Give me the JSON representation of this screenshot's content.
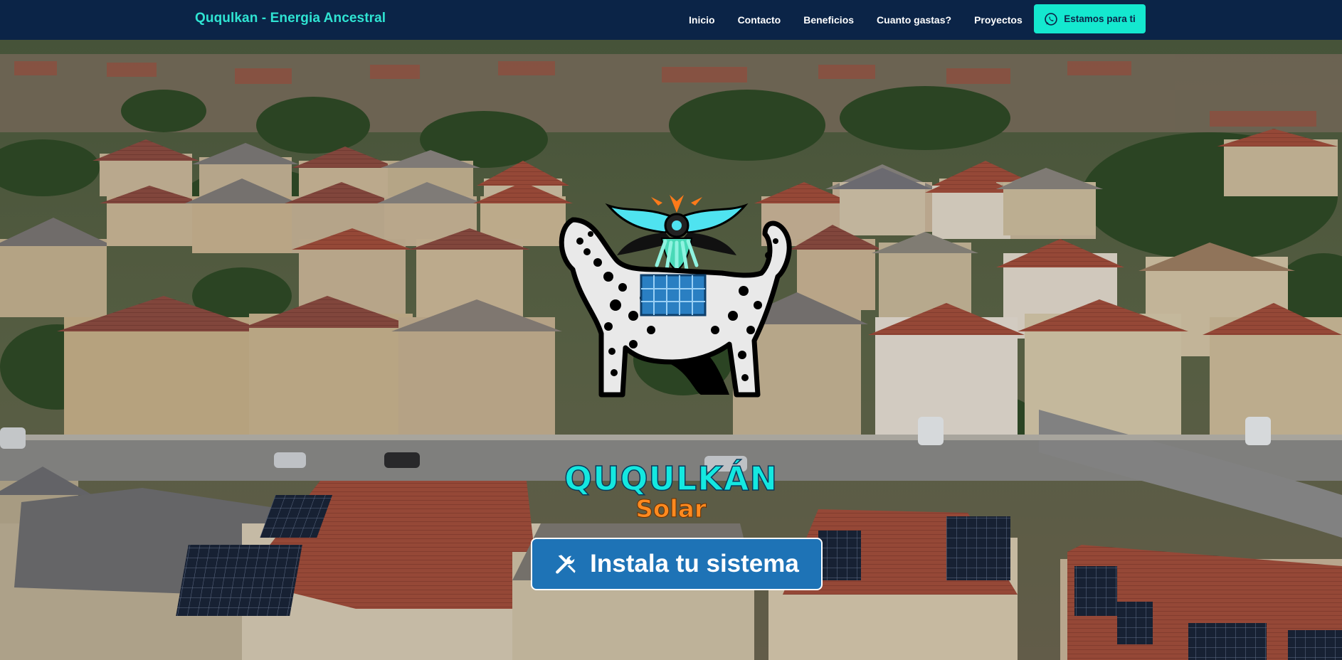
{
  "navbar": {
    "brand": "Ququlkan - Energia Ancestral",
    "links": [
      "Inicio",
      "Contacto",
      "Beneficios",
      "Cuanto gastas?",
      "Proyectos"
    ],
    "whatsapp_label": "Estamos para ti",
    "whatsapp_icon": "whatsapp-icon"
  },
  "hero": {
    "logo_icon": "jaguar-sun-logo",
    "title": "QUQULKÁN",
    "subtitle": "Solar",
    "cta_label": "Instala tu sistema",
    "cta_icon": "tools-icon"
  },
  "colors": {
    "navbar_bg": "#0b2447",
    "brand_text": "#2fe3d2",
    "whatsapp_button": "#14e8cf",
    "cta_button": "#1e73b6",
    "title": "#14e8e0",
    "subtitle": "#ff8a1f"
  }
}
